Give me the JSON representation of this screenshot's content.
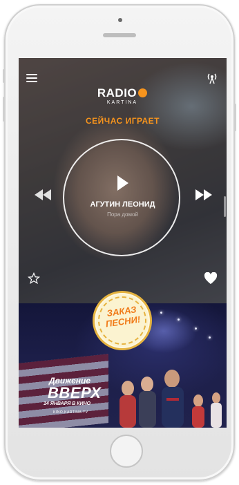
{
  "app": {
    "logo_text": "RADIO",
    "logo_sub": "KARTINA"
  },
  "player": {
    "now_playing_label": "СЕЙЧАС ИГРАЕТ",
    "artist": "АГУТИН ЛЕОНИД",
    "song": "Пора домой"
  },
  "icons": {
    "menu": "hamburger-menu-icon",
    "signal": "broadcast-icon",
    "play": "play-icon",
    "prev": "rewind-icon",
    "next": "fast-forward-icon",
    "favorite": "star-icon",
    "like": "heart-icon"
  },
  "order_button": {
    "line1": "ЗАКАЗ",
    "line2": "ПЕСНИ!"
  },
  "banner": {
    "title_line1": "Движение",
    "title_line2": "ВВЕРХ",
    "date": "14 ЯНВАРЯ В КИНО",
    "site": "KINO.KARTINA.TV"
  },
  "colors": {
    "accent": "#f7941d",
    "order_text": "#f07a18"
  }
}
